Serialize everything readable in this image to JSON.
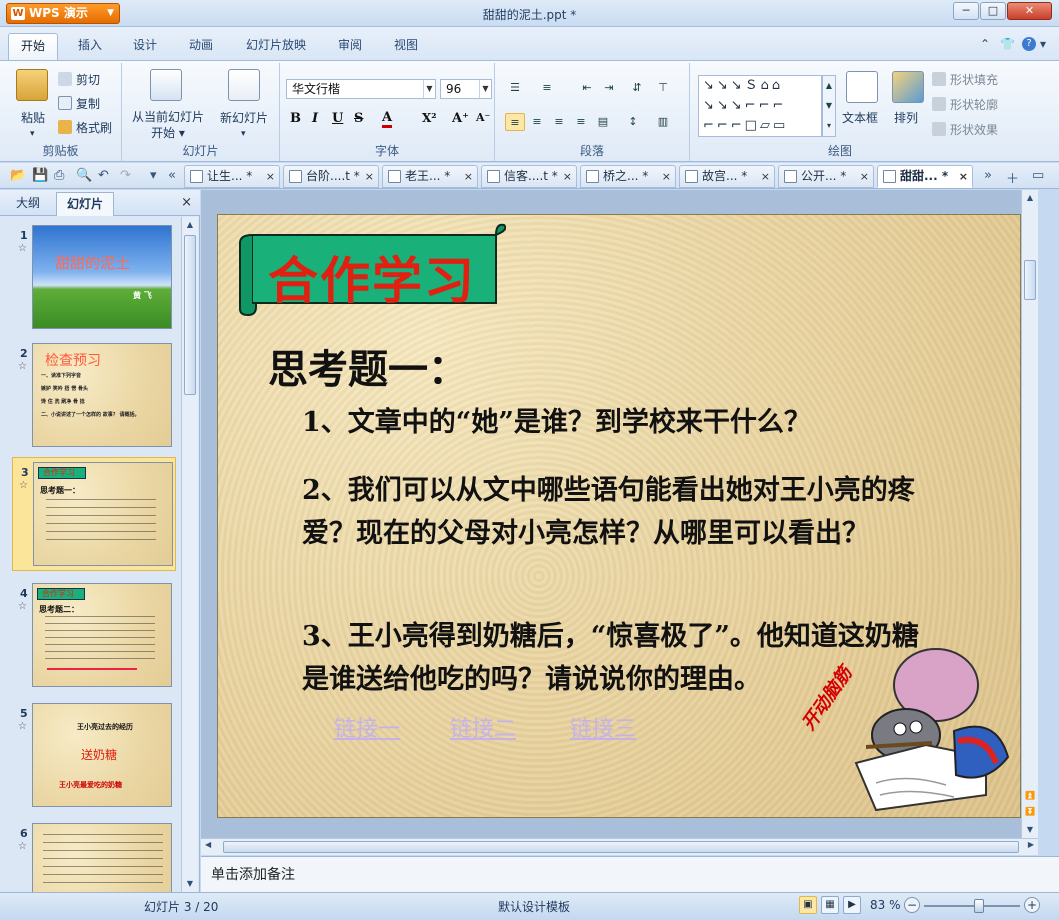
{
  "app": {
    "name": "WPS 演示",
    "window_title": "甜甜的泥土.ppt *"
  },
  "menu_tabs": [
    "开始",
    "插入",
    "设计",
    "动画",
    "幻灯片放映",
    "审阅",
    "视图"
  ],
  "ribbon": {
    "clipboard": {
      "paste": "粘贴",
      "cut": "剪切",
      "copy": "复制",
      "format_painter": "格式刷",
      "label": "剪贴板"
    },
    "slides": {
      "from_current": "从当前幻灯片",
      "start": "开始",
      "new_slide": "新幻灯片",
      "label": "幻灯片"
    },
    "font": {
      "name": "华文行楷",
      "size": "96",
      "label": "字体",
      "buttons": [
        "B",
        "I",
        "U",
        "S",
        "A",
        "X²",
        "A⁺",
        "A⁻"
      ]
    },
    "paragraph": {
      "label": "段落"
    },
    "drawing": {
      "textbox": "文本框",
      "arrange": "排列",
      "shape_fill": "形状填充",
      "shape_outline": "形状轮廓",
      "shape_effect": "形状效果",
      "label": "绘图"
    }
  },
  "doc_tabs": [
    {
      "label": "让生... *",
      "active": false
    },
    {
      "label": "台阶....t *",
      "active": false
    },
    {
      "label": "老王... *",
      "active": false
    },
    {
      "label": "信客....t *",
      "active": false
    },
    {
      "label": "桥之... *",
      "active": false
    },
    {
      "label": "故宫... *",
      "active": false
    },
    {
      "label": "公开... *",
      "active": false
    },
    {
      "label": "甜甜... *",
      "active": true
    }
  ],
  "left_pane": {
    "tabs": [
      "大纲",
      "幻灯片"
    ],
    "close": "×"
  },
  "thumbnails": [
    {
      "num": "1",
      "title": "甜甜的泥土",
      "author": "黄 飞"
    },
    {
      "num": "2",
      "title": "检查预习",
      "lines": [
        "一、读准下列字音",
        "嫉妒  笑吟  捂  愣  骨头",
        "馋 住   洗   刷净   骨 捻",
        "二、小说讲述了一个怎样的 故事？ 请概括。"
      ]
    },
    {
      "num": "3",
      "title": "合作学习",
      "heading": "思考题一："
    },
    {
      "num": "4",
      "title": "合作学习",
      "heading": "思考题二："
    },
    {
      "num": "5",
      "line1": "王小亮过去的经历",
      "line2": "送奶糖",
      "line3": "王小亮最爱吃的奶糖"
    },
    {
      "num": "6"
    }
  ],
  "slide": {
    "title": "合作学习",
    "heading": "思考题一：",
    "questions": [
      "1、文章中的“她”是谁？到学校来干什么？",
      "2、我们可以从文中哪些语句能看出她对王小亮的疼爱？现在的父母对小亮怎样？从哪里可以看出？",
      "3、王小亮得到奶糖后，“惊喜极了”。他知道这奶糖是谁送给他吃的吗？请说说你的理由。"
    ],
    "links": [
      "链接一",
      "链接二",
      "链接三"
    ],
    "decor_text": "开动脑筋"
  },
  "notes_placeholder": "单击添加备注",
  "status": {
    "slide_counter": "幻灯片 3 / 20",
    "template": "默认设计模板",
    "zoom": "83 %",
    "zoom_fraction": 0.58
  },
  "colors": {
    "accent_orange": "#e66c00",
    "title_red": "#e02010",
    "banner_green": "#19b07a",
    "link_lavender": "#c4b3ea"
  }
}
